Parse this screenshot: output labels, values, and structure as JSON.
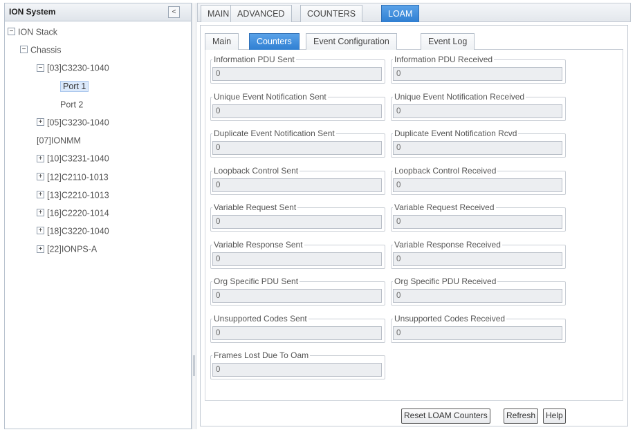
{
  "left_panel": {
    "title": "ION System",
    "collapse_glyph": "<",
    "tree": [
      {
        "label": "ION Stack",
        "toggle": "−",
        "level": 0
      },
      {
        "label": "Chassis",
        "toggle": "−",
        "level": 1
      },
      {
        "label": "[03]C3230-1040",
        "toggle": "−",
        "level": 2
      },
      {
        "label": "Port 1",
        "toggle": "",
        "level": 3,
        "selected": true
      },
      {
        "label": "Port 2",
        "toggle": "",
        "level": 3
      },
      {
        "label": "[05]C3230-1040",
        "toggle": "+",
        "level": 2
      },
      {
        "label": "[07]IONMM",
        "toggle": "",
        "level": 2
      },
      {
        "label": "[10]C3231-1040",
        "toggle": "+",
        "level": 2
      },
      {
        "label": "[12]C2110-1013",
        "toggle": "+",
        "level": 2
      },
      {
        "label": "[13]C2210-1013",
        "toggle": "+",
        "level": 2
      },
      {
        "label": "[16]C2220-1014",
        "toggle": "+",
        "level": 2
      },
      {
        "label": "[18]C3220-1040",
        "toggle": "+",
        "level": 2
      },
      {
        "label": "[22]IONPS-A",
        "toggle": "+",
        "level": 2
      }
    ]
  },
  "main_tabs": [
    {
      "label": "MAIN",
      "active": false
    },
    {
      "label": "ADVANCED",
      "active": false
    },
    {
      "label": "COUNTERS",
      "active": false
    },
    {
      "label": "LOAM",
      "active": true
    }
  ],
  "sub_tabs": [
    {
      "label": "Main",
      "active": false
    },
    {
      "label": "Counters",
      "active": true
    },
    {
      "label": "Event Configuration",
      "active": false
    },
    {
      "label": "Event Log",
      "active": false
    }
  ],
  "counters": [
    {
      "label": "Information PDU Sent",
      "value": "0"
    },
    {
      "label": "Information PDU Received",
      "value": "0"
    },
    {
      "label": "Unique Event Notification Sent",
      "value": "0"
    },
    {
      "label": "Unique Event Notification Received",
      "value": "0"
    },
    {
      "label": "Duplicate Event Notification Sent",
      "value": "0"
    },
    {
      "label": "Duplicate Event Notification Rcvd",
      "value": "0"
    },
    {
      "label": "Loopback Control Sent",
      "value": "0"
    },
    {
      "label": "Loopback Control Received",
      "value": "0"
    },
    {
      "label": "Variable Request Sent",
      "value": "0"
    },
    {
      "label": "Variable Request Received",
      "value": "0"
    },
    {
      "label": "Variable Response Sent",
      "value": "0"
    },
    {
      "label": "Variable Response Received",
      "value": "0"
    },
    {
      "label": "Org Specific PDU Sent",
      "value": "0"
    },
    {
      "label": "Org Specific PDU Received",
      "value": "0"
    },
    {
      "label": "Unsupported Codes Sent",
      "value": "0"
    },
    {
      "label": "Unsupported Codes Received",
      "value": "0"
    },
    {
      "label": "Frames Lost Due To Oam",
      "value": "0"
    }
  ],
  "buttons": {
    "reset": "Reset LOAM Counters",
    "refresh": "Refresh",
    "help": "Help"
  },
  "colors": {
    "active_tab": "#2f7fd2",
    "selected_node": "#dbe9fb"
  }
}
